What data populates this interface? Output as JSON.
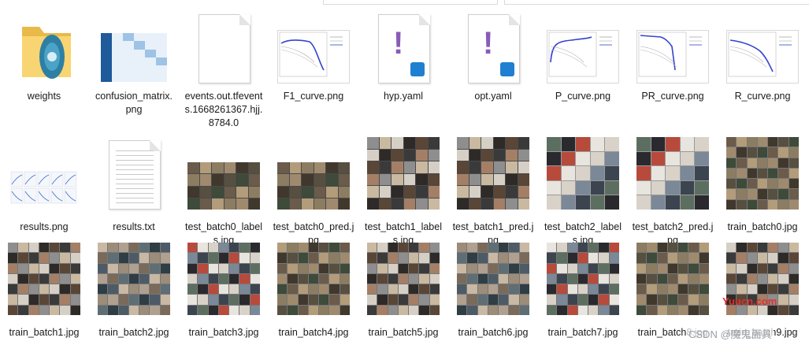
{
  "files": [
    {
      "name": "weights",
      "type": "folder"
    },
    {
      "name": "confusion_matrix.png",
      "type": "image-matrix"
    },
    {
      "name": "events.out.tfevents.1668261367.hjj.8784.0",
      "type": "generic-file"
    },
    {
      "name": "F1_curve.png",
      "type": "image-curve"
    },
    {
      "name": "hyp.yaml",
      "type": "yaml"
    },
    {
      "name": "opt.yaml",
      "type": "yaml"
    },
    {
      "name": "P_curve.png",
      "type": "image-curve"
    },
    {
      "name": "PR_curve.png",
      "type": "image-curve"
    },
    {
      "name": "R_curve.png",
      "type": "image-curve"
    },
    {
      "name": "results.png",
      "type": "image-results"
    },
    {
      "name": "results.txt",
      "type": "text-file"
    },
    {
      "name": "test_batch0_labels.jpg",
      "type": "image-batch"
    },
    {
      "name": "test_batch0_pred.jpg",
      "type": "image-batch"
    },
    {
      "name": "test_batch1_labels.jpg",
      "type": "image-batch"
    },
    {
      "name": "test_batch1_pred.jpg",
      "type": "image-batch"
    },
    {
      "name": "test_batch2_labels.jpg",
      "type": "image-batch"
    },
    {
      "name": "test_batch2_pred.jpg",
      "type": "image-batch"
    },
    {
      "name": "train_batch0.jpg",
      "type": "image-batch"
    },
    {
      "name": "train_batch1.jpg",
      "type": "image-batch"
    },
    {
      "name": "train_batch2.jpg",
      "type": "image-batch"
    },
    {
      "name": "train_batch3.jpg",
      "type": "image-batch"
    },
    {
      "name": "train_batch4.jpg",
      "type": "image-batch"
    },
    {
      "name": "train_batch5.jpg",
      "type": "image-batch"
    },
    {
      "name": "train_batch6.jpg",
      "type": "image-batch"
    },
    {
      "name": "train_batch7.jpg",
      "type": "image-batch"
    },
    {
      "name": "train_batch8.jpg",
      "type": "image-batch"
    },
    {
      "name": "train_batch9.jpg",
      "type": "image-batch"
    }
  ],
  "watermark": {
    "site": "Yuucn.com",
    "credit": "CSDN @魔鬼面具"
  },
  "icons": {
    "folder": "folder-icon",
    "yaml": "vscode-yaml-icon",
    "text": "text-file-icon",
    "generic": "blank-file-icon"
  },
  "colors": {
    "folder": "#f4c95d",
    "vscode": "#1f7fd1",
    "yaml_exclaim": "#8a5bb8"
  }
}
